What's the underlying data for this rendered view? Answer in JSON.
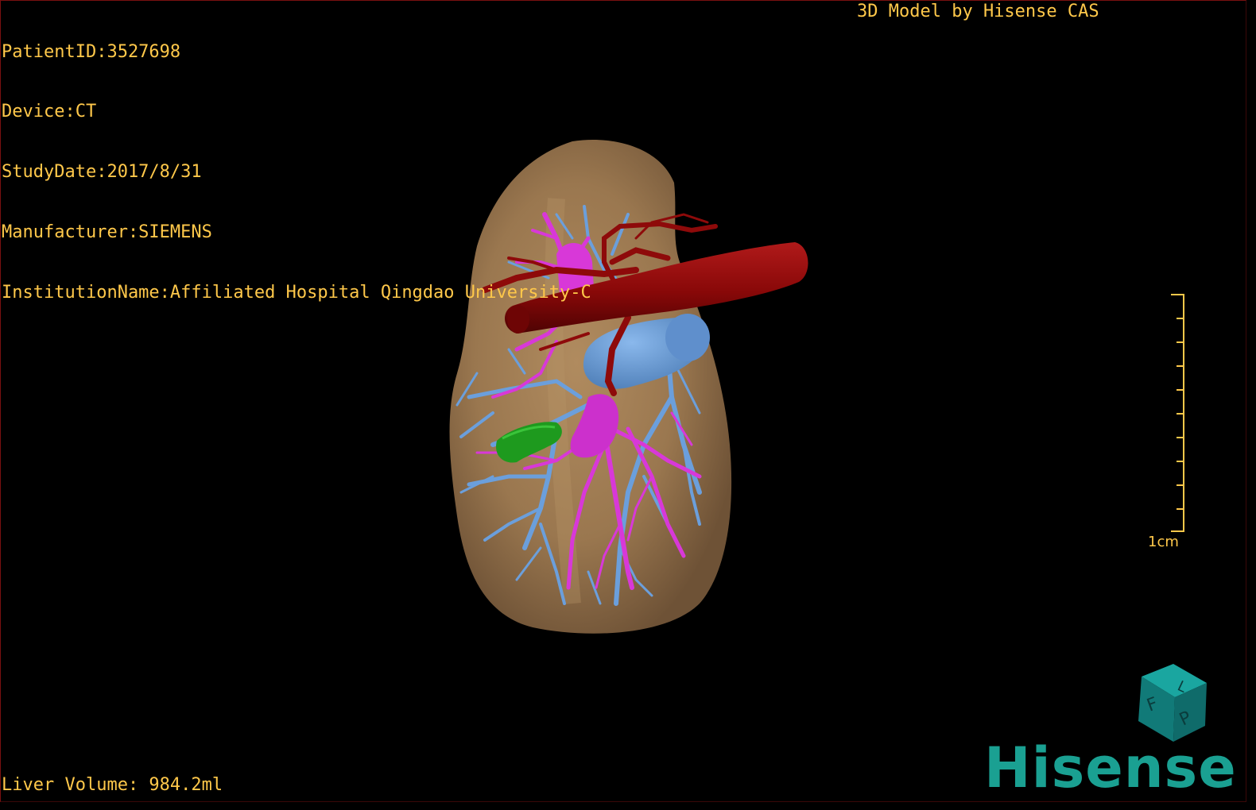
{
  "overlay": {
    "patient_id": "PatientID:3527698",
    "device": "Device:CT",
    "study_date": "StudyDate:2017/8/31",
    "manufacturer": "Manufacturer:SIEMENS",
    "institution": "InstitutionName:Affiliated Hospital Qingdao University-C",
    "model_caption": "3D Model by Hisense CAS",
    "liver_volume": "Liver Volume: 984.2ml"
  },
  "scale": {
    "label": "1cm"
  },
  "orientation_cube": {
    "face_letters": [
      "F",
      "L",
      "P"
    ]
  },
  "logo": {
    "text": "Hisense"
  },
  "colors": {
    "overlay_text": "#ffc84a",
    "liver": "#9c7a52",
    "artery": "#8e0a0a",
    "portal_vein": "#6b9fdc",
    "hepatic_vein": "#d838d8",
    "lesion": "#1e9a1e",
    "cube": "#138c88",
    "logo": "#1aa092"
  }
}
